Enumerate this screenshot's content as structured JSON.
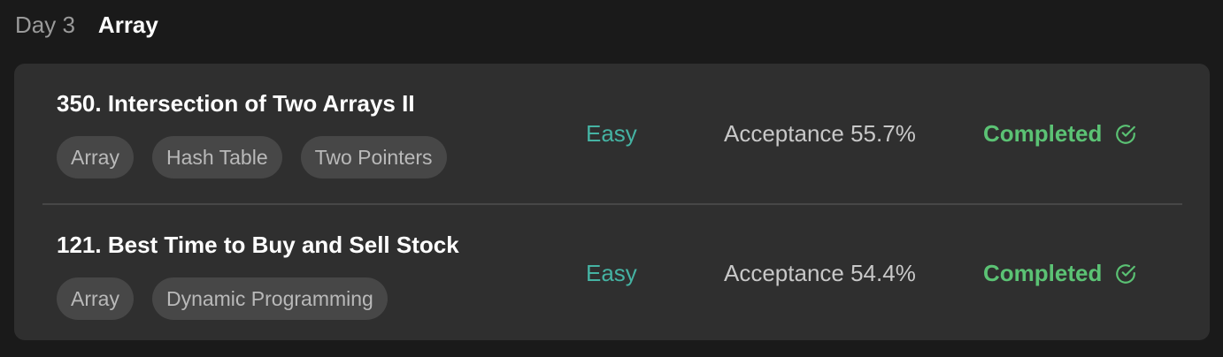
{
  "header": {
    "day_label": "Day 3",
    "topic_title": "Array"
  },
  "problems": [
    {
      "title": "350. Intersection of Two Arrays II",
      "tags": [
        "Array",
        "Hash Table",
        "Two Pointers"
      ],
      "difficulty": "Easy",
      "acceptance": "Acceptance 55.7%",
      "status": "Completed",
      "status_icon": "check-circle-icon"
    },
    {
      "title": "121. Best Time to Buy and Sell Stock",
      "tags": [
        "Array",
        "Dynamic Programming"
      ],
      "difficulty": "Easy",
      "acceptance": "Acceptance 54.4%",
      "status": "Completed",
      "status_icon": "check-circle-icon"
    }
  ],
  "colors": {
    "background": "#1a1a1a",
    "card": "#2f2f2f",
    "tag": "#474747",
    "easy": "#45b3a3",
    "completed": "#5bc274"
  }
}
